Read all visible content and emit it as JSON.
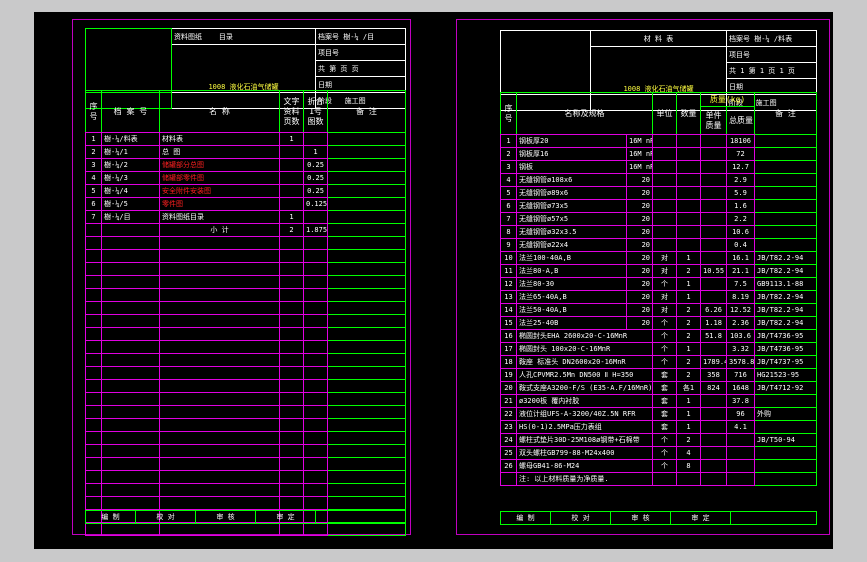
{
  "left": {
    "title_block": {
      "drawing_title": "资料图纸",
      "subtitle": "目录",
      "archive_label": "档案号 樹-¼ /目",
      "project_label": "项目号",
      "pages_label": "共 第 页 页",
      "date_label": "日期",
      "stage_label": "阶段",
      "stage_value": "施工图",
      "project_name": "1008 液化石油气储罐"
    },
    "columns": [
      "序号",
      "档 案 号",
      "名 称",
      "文字资料页数",
      "折合1号图数",
      "备 注"
    ],
    "rows": [
      {
        "no": "1",
        "code": "樹-¼/料表",
        "name": "材料表",
        "pages": "1",
        "sheets": "",
        "note": "",
        "red": false
      },
      {
        "no": "2",
        "code": "樹-¼/1",
        "name": "总 图",
        "pages": "",
        "sheets": "1",
        "note": "",
        "red": false
      },
      {
        "no": "3",
        "code": "樹-¼/2",
        "name": "储罐部分总图",
        "pages": "",
        "sheets": "0.25",
        "note": "",
        "red": true
      },
      {
        "no": "4",
        "code": "樹-¼/3",
        "name": "储罐部零件图",
        "pages": "",
        "sheets": "0.25",
        "note": "",
        "red": true
      },
      {
        "no": "5",
        "code": "樹-¼/4",
        "name": "安全附件安装图",
        "pages": "",
        "sheets": "0.25",
        "note": "",
        "red": true
      },
      {
        "no": "6",
        "code": "樹-¼/5",
        "name": "零件图",
        "pages": "",
        "sheets": "0.125",
        "note": "",
        "red": true
      },
      {
        "no": "7",
        "code": "樹-¼/目",
        "name": "资料图纸目录",
        "pages": "1",
        "sheets": "",
        "note": "",
        "red": false
      },
      {
        "no": "",
        "code": "",
        "name": "小 计",
        "pages": "2",
        "sheets": "1.875",
        "note": "",
        "red": false
      }
    ],
    "signatures": [
      "编 制",
      "校 对",
      "审 核",
      "审 定"
    ]
  },
  "right": {
    "title_block": {
      "drawing_title": "材 料 表",
      "archive_label": "档案号 樹-¼ /料表",
      "project_label": "项目号",
      "pages_label": "共 1 第 1 页 1 页",
      "date_label": "日期",
      "stage_label": "阶段",
      "stage_value": "施工图",
      "project_name": "1008 液化石油气储罐"
    },
    "columns": [
      "序号",
      "名称及规格",
      "单位",
      "数量",
      "质量(kg)",
      "单件质量",
      "总质量",
      "备 注"
    ],
    "rows": [
      {
        "no": "1",
        "name": "钢板厚20",
        "spec": "16M nR",
        "unit": "",
        "qty": "",
        "unit_mass": "",
        "total": "18106",
        "note": ""
      },
      {
        "no": "2",
        "name": "钢板厚16",
        "spec": "16M nR",
        "unit": "",
        "qty": "",
        "unit_mass": "",
        "total": "72",
        "note": ""
      },
      {
        "no": "3",
        "name": "钢板",
        "spec": "16M nR",
        "unit": "",
        "qty": "",
        "unit_mass": "",
        "total": "12.7",
        "note": ""
      },
      {
        "no": "4",
        "name": "无缝钢管ø108x6",
        "spec": "20",
        "unit": "",
        "qty": "",
        "unit_mass": "",
        "total": "2.9",
        "note": ""
      },
      {
        "no": "5",
        "name": "无缝钢管ø89x6",
        "spec": "20",
        "unit": "",
        "qty": "",
        "unit_mass": "",
        "total": "5.9",
        "note": ""
      },
      {
        "no": "6",
        "name": "无缝钢管ø73x5",
        "spec": "20",
        "unit": "",
        "qty": "",
        "unit_mass": "",
        "total": "1.6",
        "note": ""
      },
      {
        "no": "7",
        "name": "无缝钢管ø57x5",
        "spec": "20",
        "unit": "",
        "qty": "",
        "unit_mass": "",
        "total": "2.2",
        "note": ""
      },
      {
        "no": "8",
        "name": "无缝钢管ø32x3.5",
        "spec": "20",
        "unit": "",
        "qty": "",
        "unit_mass": "",
        "total": "10.6",
        "note": ""
      },
      {
        "no": "9",
        "name": "无缝钢管ø22x4",
        "spec": "20",
        "unit": "",
        "qty": "",
        "unit_mass": "",
        "total": "0.4",
        "note": ""
      },
      {
        "no": "10",
        "name": "法兰100-40A,B",
        "spec": "20",
        "unit": "对",
        "qty": "1",
        "unit_mass": "",
        "total": "16.1",
        "note": "JB/T82.2-94"
      },
      {
        "no": "11",
        "name": "法兰80-A,B",
        "spec": "20",
        "unit": "对",
        "qty": "2",
        "unit_mass": "10.55",
        "total": "21.1",
        "note": "JB/T82.2-94"
      },
      {
        "no": "12",
        "name": "法兰80-30",
        "spec": "20",
        "unit": "个",
        "qty": "1",
        "unit_mass": "",
        "total": "7.5",
        "note": "GB9113.1-88"
      },
      {
        "no": "13",
        "name": "法兰65-40A,B",
        "spec": "20",
        "unit": "对",
        "qty": "1",
        "unit_mass": "",
        "total": "8.19",
        "note": "JB/T82.2-94"
      },
      {
        "no": "14",
        "name": "法兰50-40A,B",
        "spec": "20",
        "unit": "对",
        "qty": "2",
        "unit_mass": "6.26",
        "total": "12.52",
        "note": "JB/T82.2-94"
      },
      {
        "no": "15",
        "name": "法兰25-40B",
        "spec": "20",
        "unit": "个",
        "qty": "2",
        "unit_mass": "1.18",
        "total": "2.36",
        "note": "JB/T82.2-94"
      },
      {
        "no": "16",
        "name": "椭圆封头EHA 2600x20-C-16MnR",
        "spec": "",
        "unit": "个",
        "qty": "2",
        "unit_mass": "51.8",
        "total": "103.6",
        "note": "JB/T4736-95"
      },
      {
        "no": "17",
        "name": "椭圆封头 100x20-C-16MnR",
        "spec": "",
        "unit": "个",
        "qty": "1",
        "unit_mass": "",
        "total": "3.32",
        "note": "JB/T4736-95"
      },
      {
        "no": "18",
        "name": "鞍座 标准头 DN2600x20-16MnR",
        "spec": "",
        "unit": "个",
        "qty": "2",
        "unit_mass": "1789.4",
        "total": "3578.8",
        "note": "JB/T4737-95"
      },
      {
        "no": "19",
        "name": "人孔CPVMR2.5Mn DN500 Ⅱ H=350",
        "spec": "",
        "unit": "套",
        "qty": "2",
        "unit_mass": "358",
        "total": "716",
        "note": "HG21523-95"
      },
      {
        "no": "20",
        "name": "鞍式支座A3200-F/S (E35-A.F/16MnR)",
        "spec": "",
        "unit": "套",
        "qty": "各1",
        "unit_mass": "824",
        "total": "1648",
        "note": "JB/T4712-92"
      },
      {
        "no": "21",
        "name": "ø3200板 覆内衬胶",
        "spec": "",
        "unit": "套",
        "qty": "1",
        "unit_mass": "",
        "total": "37.8",
        "note": ""
      },
      {
        "no": "22",
        "name": "液位计组UFS-A-3200/40Z.5N RFR",
        "spec": "",
        "unit": "套",
        "qty": "1",
        "unit_mass": "",
        "total": "96",
        "note": "外购"
      },
      {
        "no": "23",
        "name": "HS(0-1)2.5MPa压力表组",
        "spec": "",
        "unit": "套",
        "qty": "1",
        "unit_mass": "",
        "total": "4.1",
        "note": ""
      },
      {
        "no": "24",
        "name": "螺柱式垫片30D-25M108ø钢带+石棉带",
        "spec": "",
        "unit": "个",
        "qty": "2",
        "unit_mass": "",
        "total": "",
        "note": "JB/T50-94"
      },
      {
        "no": "25",
        "name": "双头螺柱GB799-88-M24x400",
        "spec": "",
        "unit": "个",
        "qty": "4",
        "unit_mass": "",
        "total": "",
        "note": ""
      },
      {
        "no": "26",
        "name": "螺母GB41-86-M24",
        "spec": "",
        "unit": "个",
        "qty": "8",
        "unit_mass": "",
        "total": "",
        "note": ""
      },
      {
        "no": "",
        "name": "注: 以上材料质量为净质量.",
        "spec": "",
        "unit": "",
        "qty": "",
        "unit_mass": "",
        "total": "",
        "note": ""
      }
    ],
    "signatures": [
      "编 制",
      "校 对",
      "审 核",
      "审 定"
    ]
  }
}
